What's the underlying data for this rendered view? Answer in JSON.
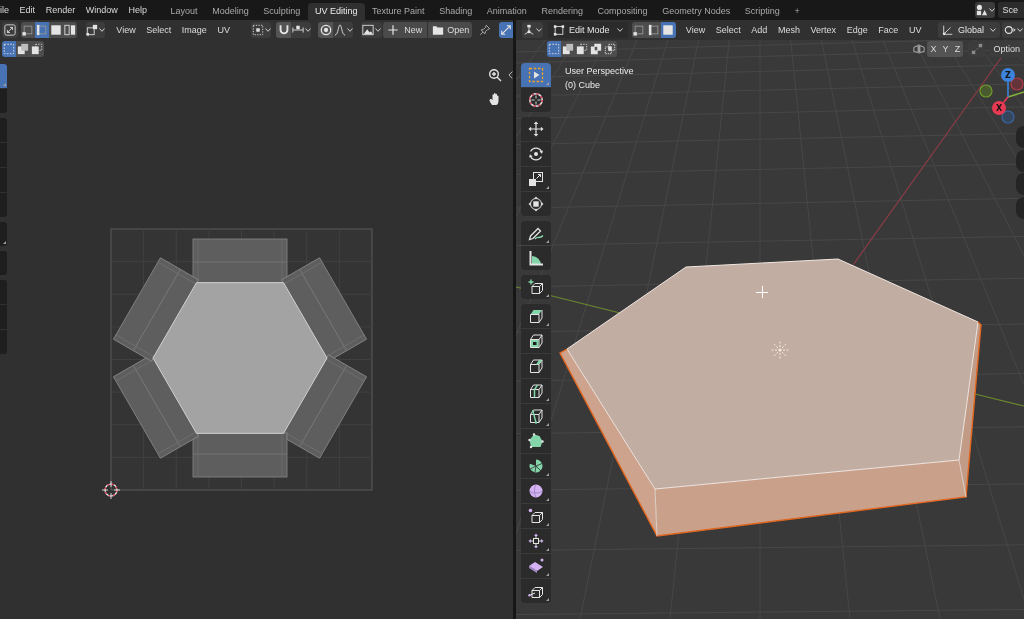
{
  "top_bar": {
    "menus": [
      "ile",
      "Edit",
      "Render",
      "Window",
      "Help"
    ],
    "workspaces": [
      {
        "label": "Layout",
        "selected": false
      },
      {
        "label": "Modeling",
        "selected": false
      },
      {
        "label": "Sculpting",
        "selected": false
      },
      {
        "label": "UV Editing",
        "selected": true
      },
      {
        "label": "Texture Paint",
        "selected": false
      },
      {
        "label": "Shading",
        "selected": false
      },
      {
        "label": "Animation",
        "selected": false
      },
      {
        "label": "Rendering",
        "selected": false
      },
      {
        "label": "Compositing",
        "selected": false
      },
      {
        "label": "Geometry Nodes",
        "selected": false
      },
      {
        "label": "Scripting",
        "selected": false
      }
    ],
    "add_workspace": "+",
    "scene": "Sce"
  },
  "uv_editor": {
    "header": {
      "select_modes": [
        {
          "kind": "vertex",
          "selected": false
        },
        {
          "kind": "edge",
          "selected": true
        },
        {
          "kind": "face",
          "selected": false
        },
        {
          "kind": "island",
          "selected": false
        }
      ],
      "menus": [
        "View",
        "Select",
        "Image",
        "UV"
      ],
      "snapping": {
        "on": false
      },
      "proportional": {
        "on": false
      },
      "new_button": "New",
      "open_button": "Open",
      "pin": {
        "on": false
      },
      "sync_selection": {
        "on": true
      }
    },
    "select_box_modes": [
      {
        "kind": "new",
        "selected": true
      },
      {
        "kind": "extend",
        "selected": false
      },
      {
        "kind": "subtract",
        "selected": false
      }
    ],
    "tool_groups": [
      {
        "tools": [
          {
            "selected": true,
            "menu": true
          },
          {
            "selected": false,
            "menu": false
          }
        ]
      },
      {
        "tools": [
          {
            "selected": false,
            "menu": false
          },
          {
            "selected": false,
            "menu": false
          },
          {
            "selected": false,
            "menu": false
          },
          {
            "selected": false,
            "menu": false
          }
        ]
      },
      {
        "tools": [
          {
            "selected": false,
            "menu": true
          }
        ]
      },
      {
        "tools": [
          {
            "selected": false,
            "menu": false
          }
        ]
      },
      {
        "tools": [
          {
            "selected": false,
            "menu": false
          },
          {
            "selected": false,
            "menu": false
          },
          {
            "selected": false,
            "menu": false
          }
        ]
      }
    ]
  },
  "viewport": {
    "header": {
      "mode": "Edit Mode",
      "select_modes": [
        {
          "kind": "vertex",
          "selected": false
        },
        {
          "kind": "edge",
          "selected": false
        },
        {
          "kind": "face",
          "selected": true
        }
      ],
      "menus": [
        "View",
        "Select",
        "Add",
        "Mesh",
        "Vertex",
        "Edge",
        "Face",
        "UV"
      ],
      "orientation": "Global"
    },
    "select_box_modes": [
      {
        "kind": "new",
        "selected": true
      },
      {
        "kind": "extend",
        "selected": false
      },
      {
        "kind": "subtract",
        "selected": false
      },
      {
        "kind": "difference",
        "selected": false
      },
      {
        "kind": "intersect",
        "selected": false
      }
    ],
    "mirror_axes": [
      {
        "label": "X",
        "on": false
      },
      {
        "label": "Y",
        "on": false
      },
      {
        "label": "Z",
        "on": false
      }
    ],
    "options_button": "Option",
    "info": [
      "User Perspective",
      "(0) Cube"
    ],
    "tool_groups": [
      {
        "tools": [
          {
            "kind": "select",
            "selected": true,
            "menu": true
          },
          {
            "kind": "cursor",
            "selected": false,
            "menu": false
          }
        ]
      },
      {
        "tools": [
          {
            "kind": "move",
            "selected": false,
            "menu": false
          },
          {
            "kind": "rotate",
            "selected": false,
            "menu": false
          },
          {
            "kind": "scale",
            "selected": false,
            "menu": true
          },
          {
            "kind": "transform",
            "selected": false,
            "menu": false
          }
        ]
      },
      {
        "tools": [
          {
            "kind": "annotate",
            "selected": false,
            "menu": true
          },
          {
            "kind": "measure",
            "selected": false,
            "menu": false
          }
        ]
      },
      {
        "tools": [
          {
            "kind": "add",
            "selected": false,
            "menu": true
          }
        ]
      },
      {
        "tools": [
          {
            "kind": "extrude",
            "selected": false,
            "menu": true
          },
          {
            "kind": "inset",
            "selected": false,
            "menu": false
          },
          {
            "kind": "bevel",
            "selected": false,
            "menu": false
          },
          {
            "kind": "loopcut",
            "selected": false,
            "menu": true
          },
          {
            "kind": "knife",
            "selected": false,
            "menu": true
          },
          {
            "kind": "polybuild",
            "selected": false,
            "menu": false
          },
          {
            "kind": "spin",
            "selected": false,
            "menu": true
          },
          {
            "kind": "smooth",
            "selected": false,
            "menu": true
          },
          {
            "kind": "slide",
            "selected": false,
            "menu": true
          },
          {
            "kind": "shrink",
            "selected": false,
            "menu": true
          },
          {
            "kind": "shear",
            "selected": false,
            "menu": true
          },
          {
            "kind": "rip",
            "selected": false,
            "menu": true
          }
        ]
      }
    ],
    "gizmo": [
      {
        "kind": "negative",
        "color": "#6f9a2a"
      },
      {
        "kind": "negative",
        "color": "#b03a48"
      },
      {
        "kind": "positive",
        "label": "Z",
        "color": "#3c83dc"
      },
      {
        "kind": "negative",
        "color": "#3b66a0"
      },
      {
        "kind": "positive",
        "label": "X",
        "color": "#e63a52"
      }
    ]
  }
}
